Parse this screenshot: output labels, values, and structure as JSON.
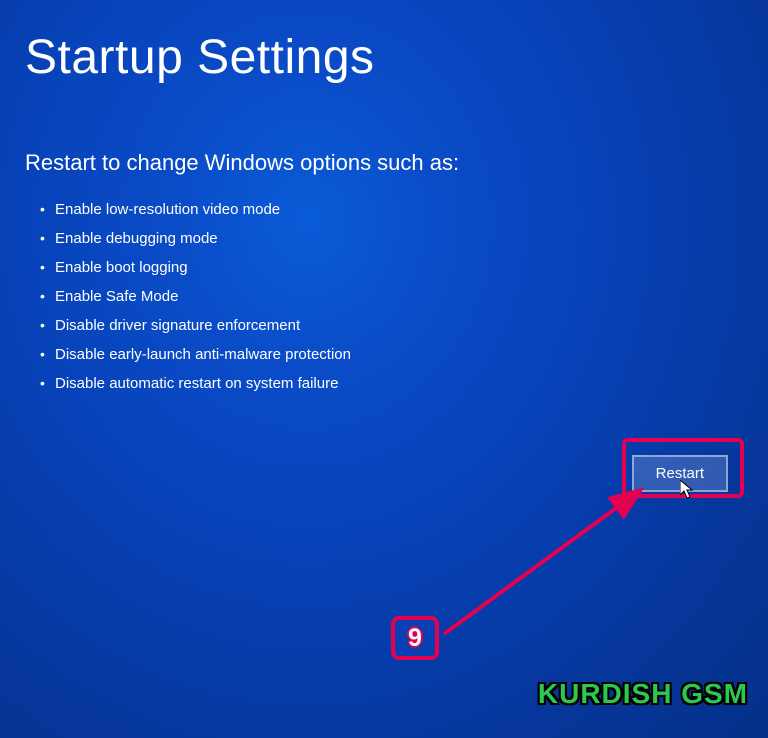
{
  "page": {
    "title": "Startup Settings",
    "subtitle": "Restart to change Windows options such as:"
  },
  "options": [
    "Enable low-resolution video mode",
    "Enable debugging mode",
    "Enable boot logging",
    "Enable Safe Mode",
    "Disable driver signature enforcement",
    "Disable early-launch anti-malware protection",
    "Disable automatic restart on system failure"
  ],
  "button": {
    "restart": "Restart"
  },
  "annotation": {
    "step_number": "9",
    "watermark": "KURDISH GSM"
  }
}
